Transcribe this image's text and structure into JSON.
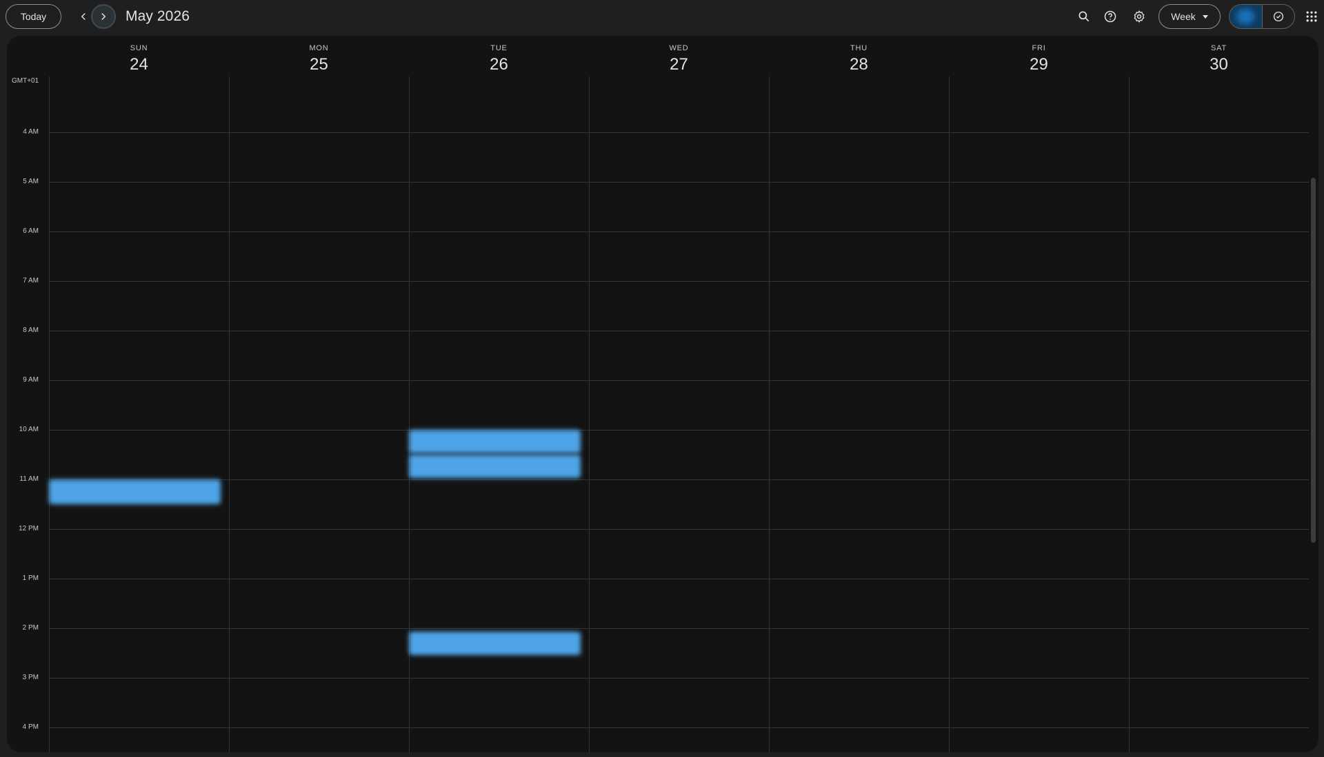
{
  "header": {
    "today_label": "Today",
    "month_title": "May 2026",
    "view_label": "Week",
    "icons": {
      "prev": "chevron-left-icon",
      "next": "chevron-right-icon",
      "search": "search-icon",
      "help": "help-icon",
      "settings": "gear-icon",
      "tasks": "check-circle-icon",
      "apps": "apps-grid-icon"
    }
  },
  "timezone": "GMT+01",
  "days": [
    {
      "name": "SUN",
      "num": "24"
    },
    {
      "name": "MON",
      "num": "25"
    },
    {
      "name": "TUE",
      "num": "26"
    },
    {
      "name": "WED",
      "num": "27"
    },
    {
      "name": "THU",
      "num": "28"
    },
    {
      "name": "FRI",
      "num": "29"
    },
    {
      "name": "SAT",
      "num": "30"
    }
  ],
  "hours": [
    "4 AM",
    "5 AM",
    "6 AM",
    "7 AM",
    "8 AM",
    "9 AM",
    "10 AM",
    "11 AM",
    "12 PM",
    "1 PM",
    "2 PM",
    "3 PM",
    "4 PM"
  ],
  "events": [
    {
      "day": "SUN",
      "start": "11 AM",
      "text": ""
    },
    {
      "day": "TUE",
      "start": "10 AM",
      "text": ""
    },
    {
      "day": "TUE",
      "start": "10 AM",
      "text": ""
    },
    {
      "day": "TUE",
      "start": "2 PM",
      "text": ""
    }
  ],
  "colors": {
    "background": "#1f1f1f",
    "panel": "#131313",
    "event": "#4ea4e6",
    "gridline": "#333537"
  }
}
